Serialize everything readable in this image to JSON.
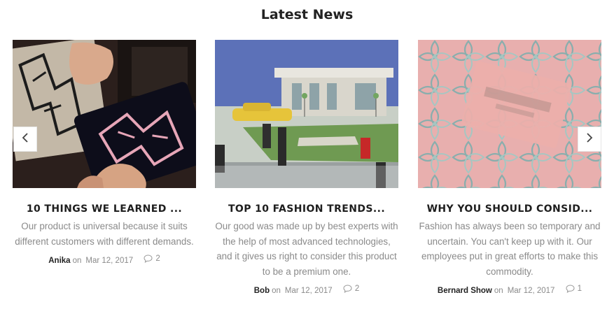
{
  "section": {
    "title": "Latest News"
  },
  "posts": [
    {
      "title": "10 THINGS WE LEARNED ...",
      "excerpt": "Our product is universal because it suits different customers with different demands.",
      "author": "Anika",
      "on": "on",
      "date": "Mar 12, 2017",
      "comments": "2"
    },
    {
      "title": "TOP 10 FASHION TRENDS...",
      "excerpt": "Our good was made up by best experts with the help of most advanced technologies, and it gives us right to consider this product to be a premium one.",
      "author": "Bob",
      "on": "on",
      "date": "Mar 12, 2017",
      "comments": "2"
    },
    {
      "title": "WHY YOU SHOULD CONSID...",
      "excerpt": "Fashion has always been so temporary and uncertain. You can't keep up with it. Our employees put in great efforts to make this commodity.",
      "author": "Bernard Show",
      "on": "on",
      "date": "Mar 12, 2017",
      "comments": "1"
    }
  ],
  "carousel": {
    "prev_icon": "chevron-left-icon",
    "next_icon": "chevron-right-icon"
  },
  "images": {
    "post_1": "clutch-bags-photo",
    "post_2": "fashion-show-set-photo",
    "post_3": "ted-baker-embossed-photo"
  },
  "colors": {
    "title": "#222222",
    "text_muted": "#8a8a8a"
  }
}
